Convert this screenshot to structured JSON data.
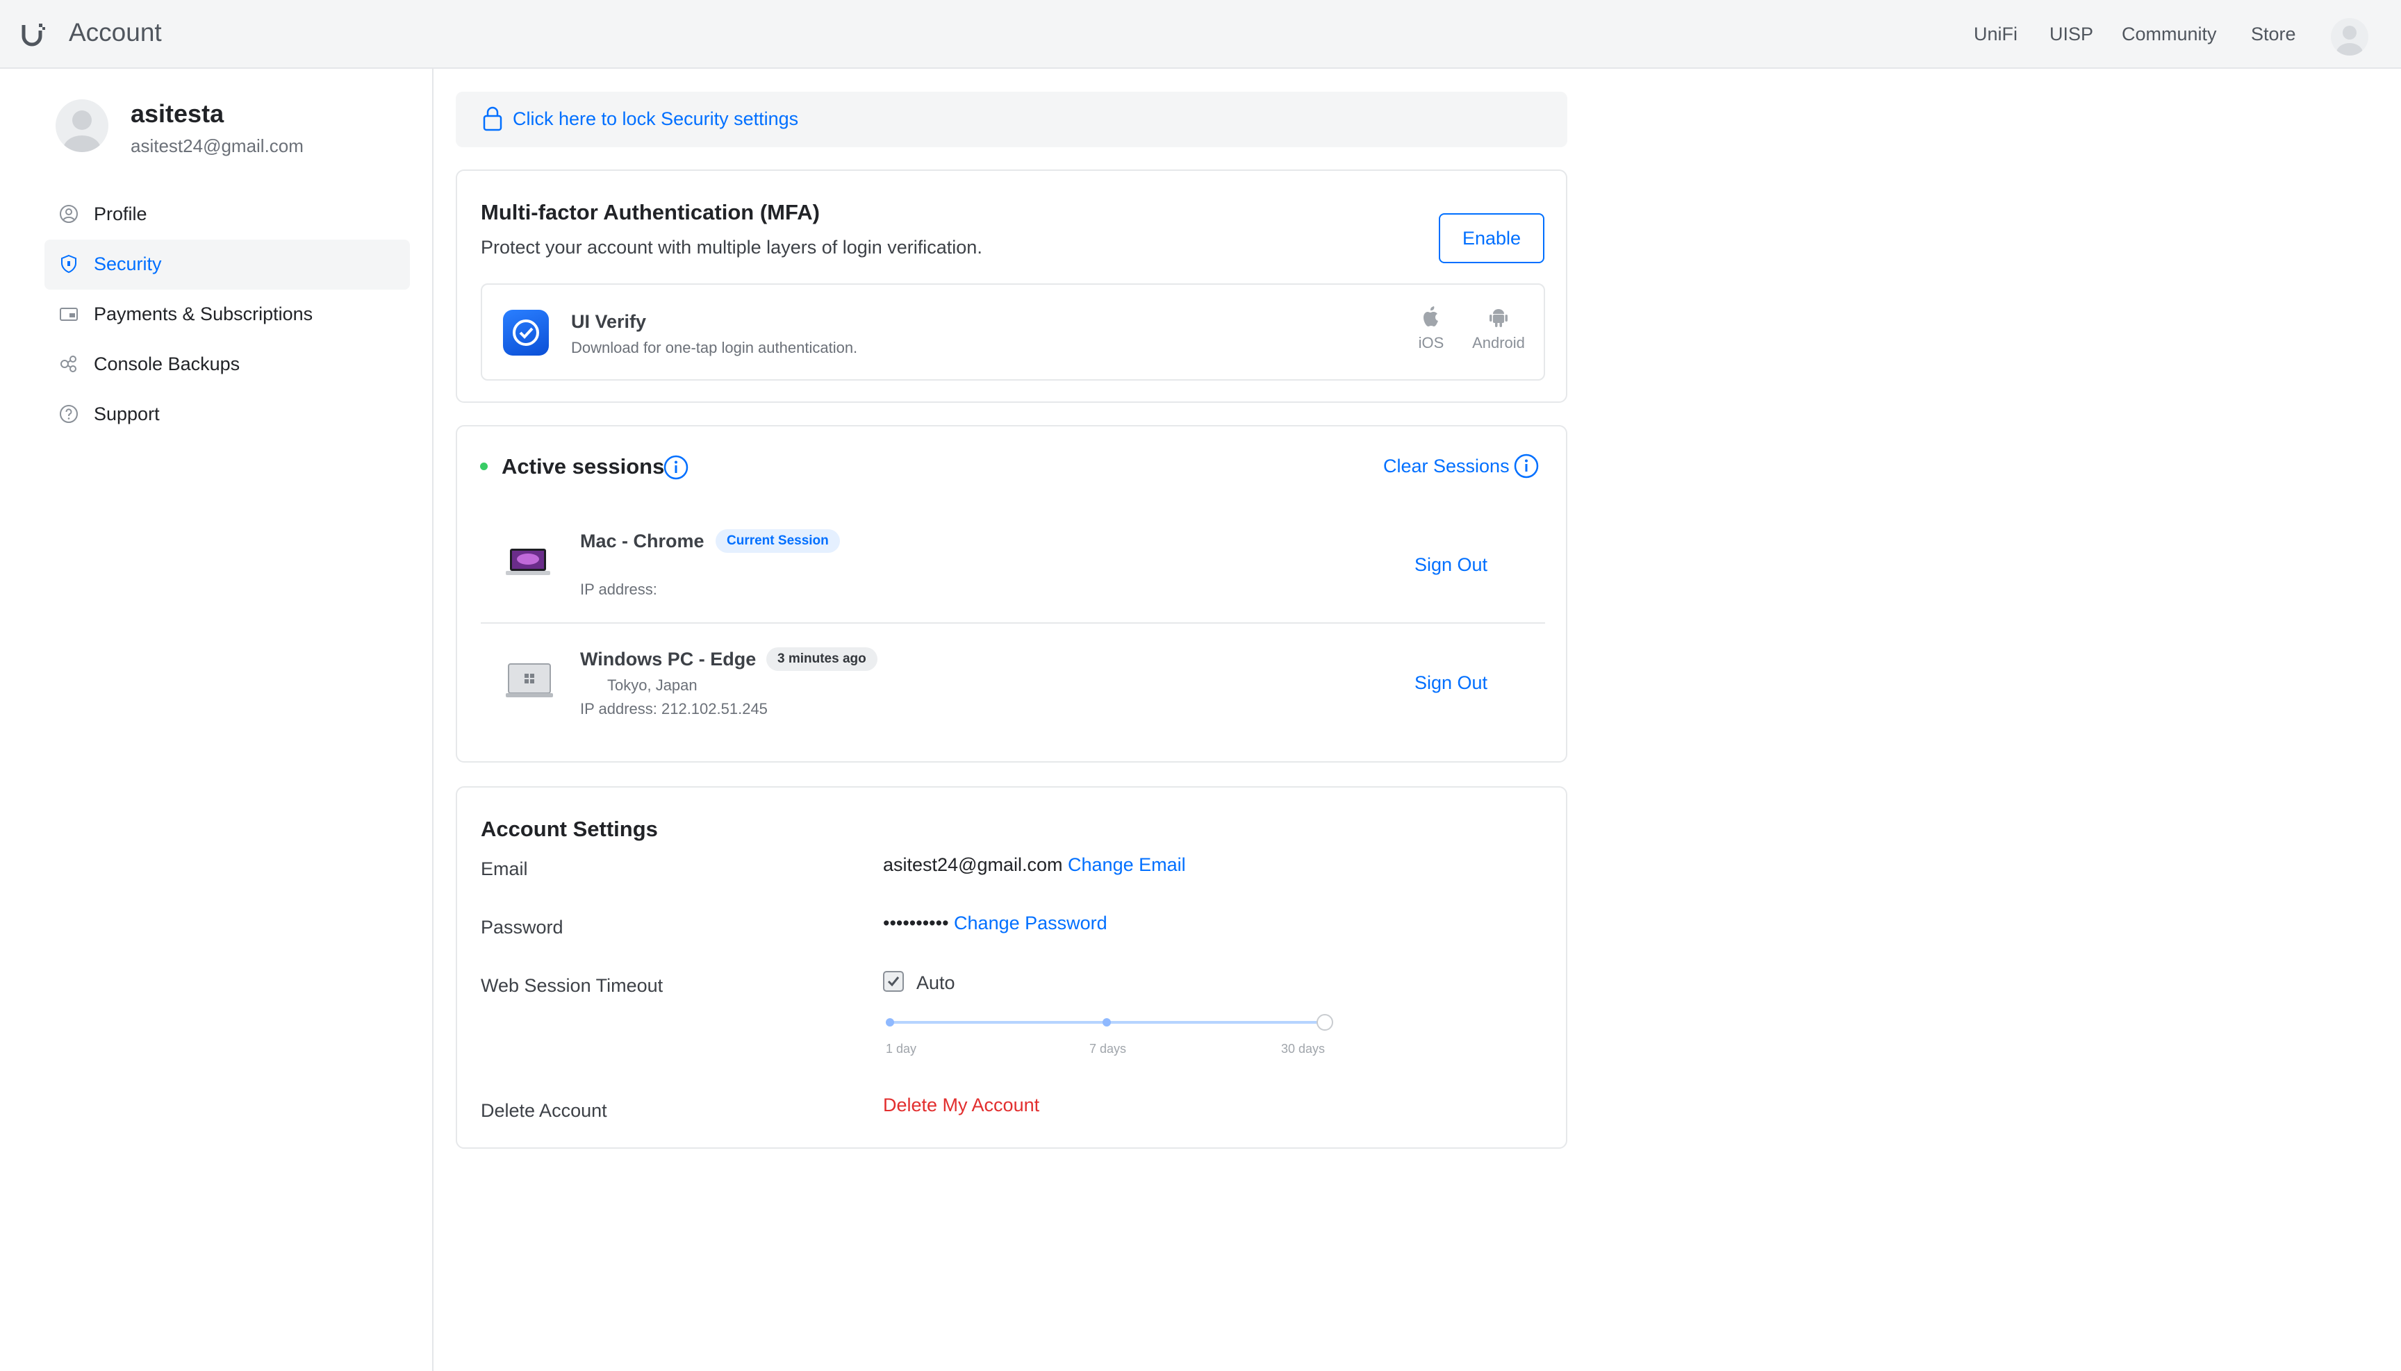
{
  "header": {
    "app_title": "Account",
    "nav": [
      "UniFi",
      "UISP",
      "Community",
      "Store"
    ]
  },
  "sidebar": {
    "user": {
      "name": "asitesta",
      "email": "asitest24@gmail.com"
    },
    "items": [
      {
        "label": "Profile",
        "icon": "user-circle-icon"
      },
      {
        "label": "Security",
        "icon": "shield-icon",
        "active": true
      },
      {
        "label": "Payments & Subscriptions",
        "icon": "wallet-icon"
      },
      {
        "label": "Console Backups",
        "icon": "backup-icon"
      },
      {
        "label": "Support",
        "icon": "help-circle-icon"
      }
    ]
  },
  "lock_bar": {
    "text": "Click here to lock Security settings"
  },
  "mfa": {
    "title": "Multi-factor Authentication (MFA)",
    "description": "Protect your account with multiple layers of login verification.",
    "enable_label": "Enable",
    "app": {
      "name": "UI Verify",
      "description": "Download for one-tap login authentication.",
      "platforms": [
        "iOS",
        "Android"
      ]
    }
  },
  "sessions": {
    "title": "Active sessions",
    "clear_label": "Clear Sessions",
    "items": [
      {
        "name": "Mac - Chrome",
        "badge": "Current Session",
        "location": "",
        "ip": "IP address:",
        "action": "Sign Out"
      },
      {
        "name": "Windows PC - Edge",
        "badge": "3 minutes ago",
        "location": "Tokyo, Japan",
        "ip": "IP address: 212.102.51.245",
        "action": "Sign Out"
      }
    ]
  },
  "account_settings": {
    "title": "Account Settings",
    "email_label": "Email",
    "email_value": "asitest24@gmail.com",
    "change_email": "Change Email",
    "password_label": "Password",
    "password_value": "••••••••••",
    "change_password": "Change Password",
    "timeout_label": "Web Session Timeout",
    "auto_label": "Auto",
    "auto_checked": true,
    "slider_ticks": [
      "1 day",
      "7 days",
      "30 days"
    ],
    "delete_label": "Delete Account",
    "delete_action": "Delete My Account"
  },
  "colors": {
    "accent": "#006fff",
    "danger": "#e22e2e",
    "online": "#38cc65"
  }
}
